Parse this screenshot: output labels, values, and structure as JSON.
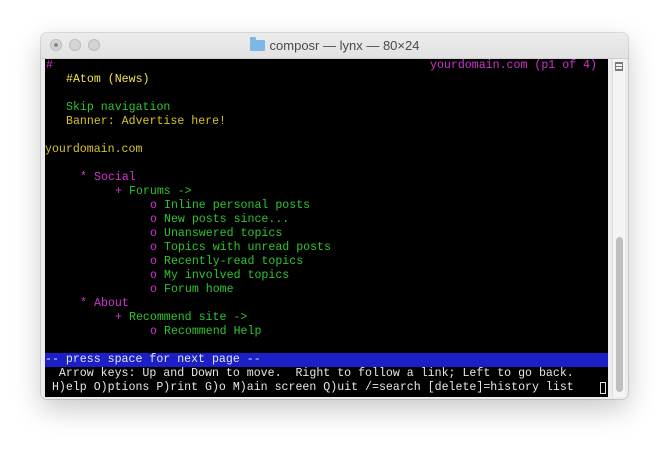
{
  "window": {
    "title": "composr — lynx — 80×24"
  },
  "terminal": {
    "corner_hash": "#",
    "page_indicator": "yourdomain.com (p1 of 4)",
    "atom_link": "#Atom (News)",
    "skip_navigation": "Skip navigation",
    "banner": "Banner: Advertise here!",
    "site_link": "yourdomain.com",
    "menu": {
      "social_bullet": "*",
      "social": "Social",
      "forums_bullet": "+",
      "forums": "Forums ->",
      "forum_items": [
        {
          "bullet": "o",
          "label": "Inline personal posts"
        },
        {
          "bullet": "o",
          "label": "New posts since..."
        },
        {
          "bullet": "o",
          "label": "Unanswered topics"
        },
        {
          "bullet": "o",
          "label": "Topics with unread posts"
        },
        {
          "bullet": "o",
          "label": "Recently-read topics"
        },
        {
          "bullet": "o",
          "label": "My involved topics"
        },
        {
          "bullet": "o",
          "label": "Forum home"
        }
      ],
      "about_bullet": "*",
      "about": "About",
      "recommend_bullet": "+",
      "recommend_site": "Recommend site ->",
      "recommend_help_bullet": "o",
      "recommend_help": "Recommend Help"
    },
    "status_bar": "-- press space for next page --",
    "help_line_1": "  Arrow keys: Up and Down to move.  Right to follow a link; Left to go back.",
    "help_line_2": " H)elp O)ptions P)rint G)o M)ain screen Q)uit /=search [delete]=history list"
  },
  "colors": {
    "background": "#000000",
    "link_green": "#2fc42f",
    "text_yellow": "#d6c32a",
    "bullet_magenta": "#cf33cf",
    "status_blue": "#1a1fc7"
  }
}
